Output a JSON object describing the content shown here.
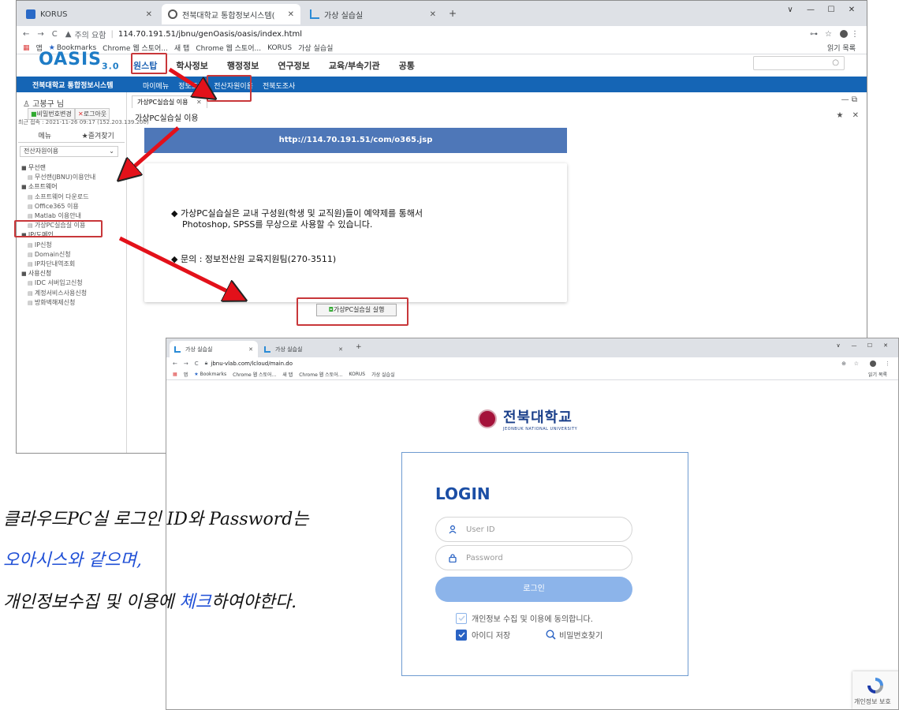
{
  "window1": {
    "tabs": [
      {
        "label": "KORUS"
      },
      {
        "label": "전북대학교 통합정보시스템(OA)"
      },
      {
        "label": "가상 실습실"
      }
    ],
    "new_tab": "+",
    "window_buttons": [
      "∨",
      "—",
      "☐",
      "✕"
    ],
    "address": {
      "security": "주의 요함",
      "url": "114.70.191.51/jbnu/genOasis/oasis/index.html"
    },
    "bookmarks": [
      "앱",
      "Bookmarks",
      "Chrome 웹 스토어...",
      "새 탭",
      "Chrome 웹 스토어...",
      "KORUS",
      "가상 실습실"
    ],
    "reading_list": "읽기 목록",
    "logo": {
      "main": "OASIS",
      "version": "3.0"
    },
    "main_nav": [
      "원스탑",
      "학사정보",
      "행정정보",
      "연구정보",
      "교육/부속기관",
      "공통"
    ],
    "system_name": "전북대학교 통합정보시스템",
    "sub_nav": [
      "마이메뉴",
      "정보조회",
      "전산자원이용",
      "전북도조사"
    ],
    "sidebar": {
      "user": "고봉구 님",
      "change_pw": "비밀번호변경",
      "logout": "로그아웃",
      "last_login": "최근 접속 : 2021-11-26 09:17 (152.203.139.200)",
      "tab_menu": "메뉴",
      "tab_fav": "★즐겨찾기",
      "select_value": "전산자원이용",
      "tree": [
        {
          "type": "cat",
          "label": "무선랜"
        },
        {
          "type": "leaf",
          "label": "무선랜(JBNU)이용안내"
        },
        {
          "type": "cat",
          "label": "소프트웨어"
        },
        {
          "type": "leaf",
          "label": "소프트웨어 다운로드"
        },
        {
          "type": "leaf",
          "label": "Office365 이용"
        },
        {
          "type": "leaf",
          "label": "Matlab 이용안내"
        },
        {
          "type": "leaf",
          "label": "가상PC실습실 이용"
        },
        {
          "type": "cat",
          "label": "IP/도메인"
        },
        {
          "type": "leaf",
          "label": "IP신청"
        },
        {
          "type": "leaf",
          "label": "Domain신청"
        },
        {
          "type": "leaf",
          "label": "IP차단내역조회"
        },
        {
          "type": "cat",
          "label": "사용신청"
        },
        {
          "type": "leaf",
          "label": "IDC 서버입고신청"
        },
        {
          "type": "leaf",
          "label": "계정서비스사용신청"
        },
        {
          "type": "leaf",
          "label": "방화벽해제신청"
        }
      ]
    },
    "content": {
      "tab_label": "가상PC실습실 이용",
      "title": "가상PC실습실 이용",
      "url_banner": "http://114.70.191.51/com/o365.jsp",
      "notice_line1": "◆ 가상PC실습실은 교내 구성원(학생 및 교직원)들이 예약제를 통해서",
      "notice_line2": "Photoshop, SPSS를 무상으로 사용할 수 있습니다.",
      "notice_line3": "◆ 문의 : 정보전산원 교육지원팀(270-3511)",
      "run_button": "가상PC실습실 실행"
    }
  },
  "window2": {
    "tabs": [
      {
        "label": "가상 실습실"
      },
      {
        "label": "가상 실습실"
      }
    ],
    "new_tab": "+",
    "window_buttons": [
      "∨",
      "—",
      "☐",
      "✕"
    ],
    "address": {
      "url": "jbnu-vlab.com/lcloud/main.do"
    },
    "bookmarks": [
      "앱",
      "Bookmarks",
      "Chrome 웹 스토어...",
      "새 탭",
      "Chrome 웹 스토어...",
      "KORUS",
      "가상 실습실"
    ],
    "reading_list": "읽기 목록",
    "univ_name_ko": "전북대학교",
    "univ_name_en": "JEONBUK NATIONAL UNIVERSITY",
    "login": {
      "heading": "LOGIN",
      "id_placeholder": "User ID",
      "pw_placeholder": "Password",
      "button": "로그인",
      "agree_label": "개인정보 수집 및 이용에 동의합니다.",
      "remember_label": "아이디 저장",
      "find_pw_label": "비밀번호찾기"
    },
    "recaptcha_text": "개인정보 보호"
  },
  "caption": {
    "line1": "클라우드PC실 로그인 ID와 Password는",
    "line2": "오아시스와 같으며,",
    "line3_pre": "개인정보수집 및 이용에 ",
    "line3_blue": "체크",
    "line3_post": "하여야한다."
  },
  "colors": {
    "annotation_red": "#c8373a",
    "arrow_red": "#e3111a",
    "oasis_blue": "#1565b5",
    "login_blue": "#1b4ea5",
    "caption_blue": "#1f4fd6"
  }
}
